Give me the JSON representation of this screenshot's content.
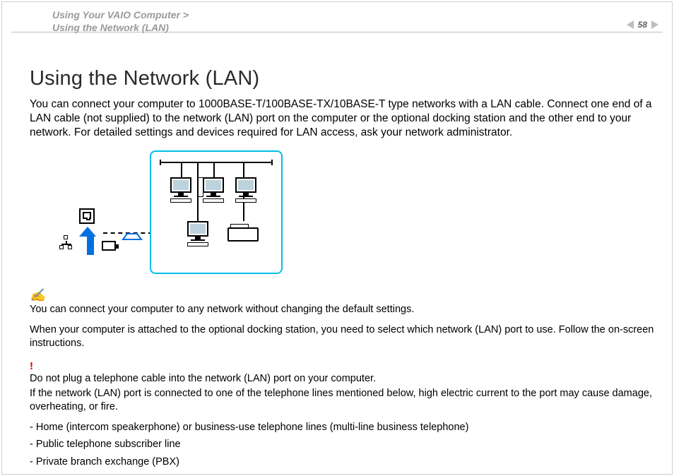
{
  "breadcrumb": {
    "section": "Using Your VAIO Computer",
    "separator": ">",
    "page": "Using the Network (LAN)"
  },
  "page_number": "58",
  "title": "Using the Network (LAN)",
  "intro": "You can connect your computer to 1000BASE-T/100BASE-TX/10BASE-T type networks with a LAN cable. Connect one end of a LAN cable (not supplied) to the network (LAN) port on the computer or the optional docking station and the other end to your network. For detailed settings and devices required for LAN access, ask your network administrator.",
  "note_icon": "✍",
  "note1": "You can connect your computer to any network without changing the default settings.",
  "note2": "When your computer is attached to the optional docking station, you need to select which network (LAN) port to use. Follow the on-screen instructions.",
  "warn_icon": "!",
  "warn_line1": "Do not plug a telephone cable into the network (LAN) port on your computer.",
  "warn_line2": "If the network (LAN) port is connected to one of the telephone lines mentioned below, high electric current to the port may cause damage, overheating, or fire.",
  "bullets": {
    "b1": "- Home (intercom speakerphone) or business-use telephone lines (multi-line business telephone)",
    "b2": "- Public telephone subscriber line",
    "b3": "- Private branch exchange (PBX)"
  }
}
